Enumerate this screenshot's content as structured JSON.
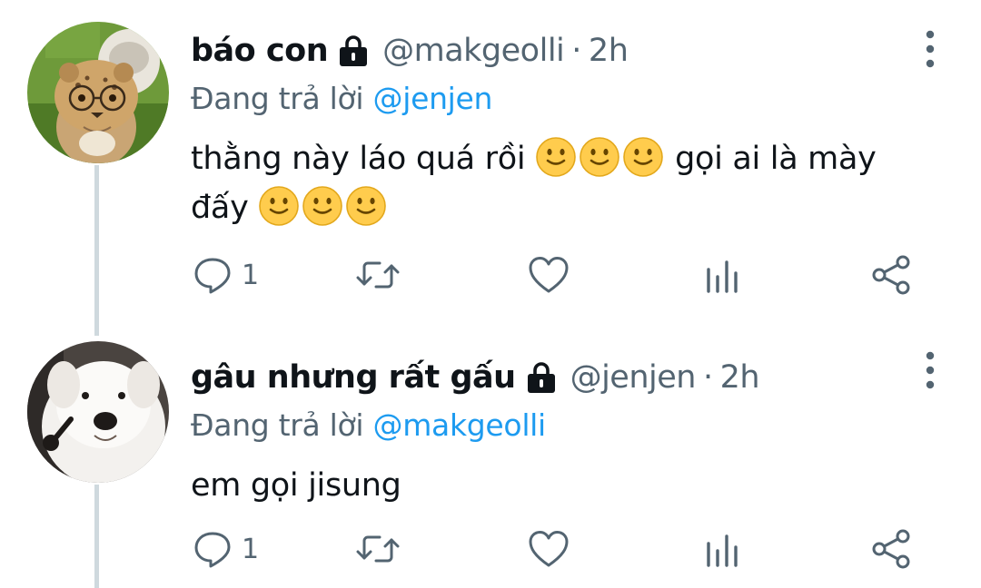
{
  "tweets": [
    {
      "display_name": "báo con",
      "handle": "@makgeolli",
      "separator": "·",
      "time": "2h",
      "reply_prefix": "Đang trả lời",
      "reply_to": "@jenjen",
      "text_1": "thằng này láo quá rồi",
      "text_2": "gọi ai là mày",
      "text_3": "đấy",
      "reply_count": "1",
      "avatar_icon": "cheetah-cub-with-glasses"
    },
    {
      "display_name": "gâu nhưng rất gấu",
      "handle": "@jenjen",
      "separator": "·",
      "time": "2h",
      "reply_prefix": "Đang trả lời",
      "reply_to": "@makgeolli",
      "text_1": "em gọi jisung",
      "reply_count": "1",
      "avatar_icon": "white-samoyed-dog"
    }
  ],
  "emoji_name": "slightly-smiling-face",
  "icons": [
    "lock-icon",
    "more-vertical-icon",
    "reply-icon",
    "retweet-icon",
    "like-icon",
    "views-icon",
    "share-icon"
  ],
  "colors": {
    "text": "#0f1419",
    "secondary": "#536471",
    "link": "#1d9bf0",
    "thread_line": "#cfd9de"
  }
}
